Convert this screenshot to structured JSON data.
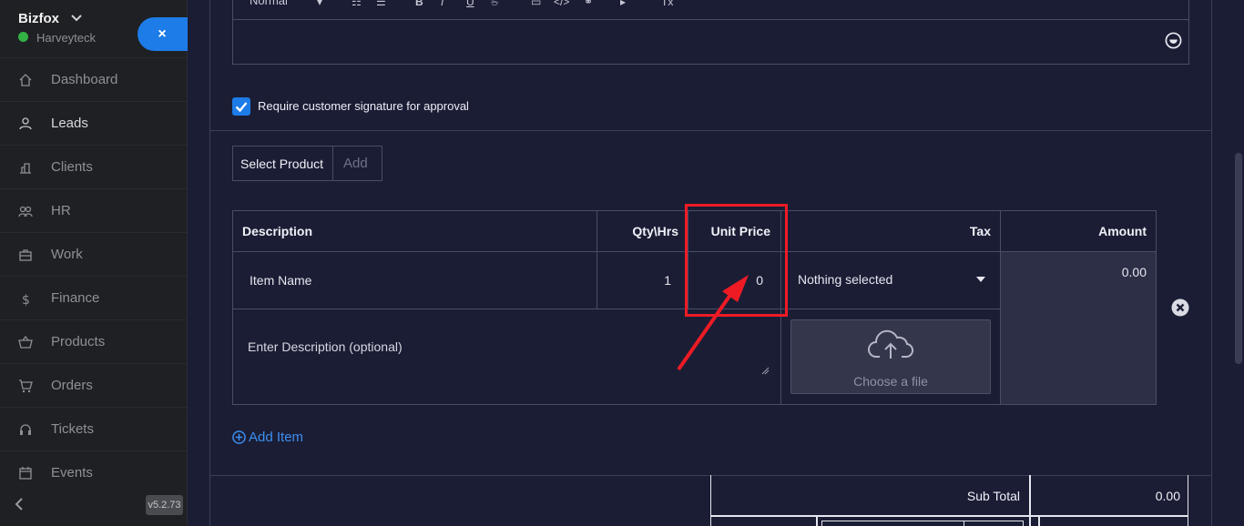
{
  "sidebar": {
    "brand": "Bizfox",
    "company": "Harveyteck",
    "close_label": "×",
    "items": [
      {
        "label": "Dashboard"
      },
      {
        "label": "Leads"
      },
      {
        "label": "Clients"
      },
      {
        "label": "HR"
      },
      {
        "label": "Work"
      },
      {
        "label": "Finance"
      },
      {
        "label": "Products"
      },
      {
        "label": "Orders"
      },
      {
        "label": "Tickets"
      },
      {
        "label": "Events"
      }
    ],
    "active_item": "Leads",
    "version": "v5.2.73"
  },
  "editor": {
    "format_select": "Normal",
    "signature_label": "Require customer signature for approval",
    "signature_checked": true
  },
  "product": {
    "select_label": "Select Product",
    "add_placeholder": "Add"
  },
  "items_table": {
    "headers": {
      "description": "Description",
      "qty": "Qty\\Hrs",
      "unit_price": "Unit Price",
      "tax": "Tax",
      "amount": "Amount"
    },
    "row": {
      "item_name": "Item Name",
      "qty": "1",
      "unit_price": "0",
      "tax": "Nothing selected",
      "amount": "0.00",
      "description_placeholder": "Enter Description (optional)",
      "file_label": "Choose a file"
    },
    "add_item_label": "Add Item"
  },
  "totals": {
    "sub_total_label": "Sub Total",
    "sub_total_value": "0.00"
  },
  "colors": {
    "accent": "#1d7ce8",
    "highlight": "#ee1b24",
    "panel_bg": "#1b1d35",
    "sidebar_bg": "#1f2023"
  }
}
